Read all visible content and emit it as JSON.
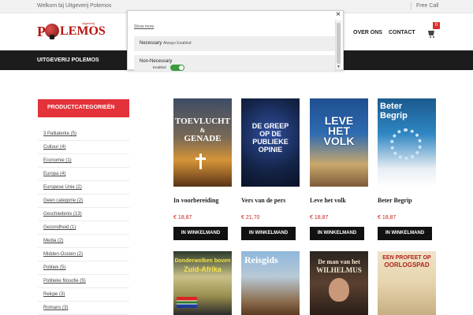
{
  "topbar": {
    "welcome": "Welkom bij Uitgeverij Polemos",
    "call": "Free Call"
  },
  "logo": {
    "text_p": "P",
    "text_rest": "LEMOS",
    "subtitle": "uitgeverij"
  },
  "nav": {
    "over_ons": "OVER ONS",
    "contact": "CONTACT",
    "cart_count": "0"
  },
  "darkbar": {
    "brand": "UITGEVERIJ POLEMOS"
  },
  "cookie": {
    "show_more": "Show more",
    "necessary": "Necessary",
    "always_enabled": "Always Enabled",
    "non_necessary": "Non-Necessary",
    "enabled": "Enabled",
    "close": "×"
  },
  "sidebar": {
    "title": "PRODUCTCATEGORIEËN",
    "items": [
      "3 Palliaterke (5)",
      "Cultuur (4)",
      "Economie (1)",
      "Europa (4)",
      "Europese Unie (2)",
      "Geen categorie (2)",
      "Geschiedenis (13)",
      "Gezondheid (1)",
      "Media (2)",
      "Midden-Oosten (2)",
      "Politiek (5)",
      "Politieke filosofie (5)",
      "Religie (3)",
      "Romans (3)"
    ]
  },
  "products": [
    {
      "title": "In voorbereiding",
      "price": "€ 18,87",
      "button": "IN WINKELMAND",
      "cover_text": [
        "TOEVLUCHT",
        "&",
        "GENADE"
      ]
    },
    {
      "title": "Vers van de pers",
      "price": "€ 21,70",
      "button": "IN WINKELMAND",
      "cover_text": [
        "DE GREEP",
        "OP DE",
        "PUBLIEKE",
        "OPINIE"
      ]
    },
    {
      "title": "Leve het volk",
      "price": "€ 18,87",
      "button": "IN WINKELMAND",
      "cover_text": [
        "LEVE",
        "HET",
        "VOLK"
      ]
    },
    {
      "title": "Beter Begrip",
      "price": "€ 18,87",
      "button": "IN WINKELMAND",
      "cover_text": [
        "Beter",
        "Begrip"
      ]
    }
  ],
  "products_row2": [
    {
      "cover_text": [
        "Donderwolken boven",
        "Zuid-Afrika"
      ]
    },
    {
      "cover_text": [
        "Reisgids"
      ]
    },
    {
      "cover_text": [
        "De man van het",
        "WILHELMUS"
      ]
    },
    {
      "cover_text": [
        "EEN PROFEET OP",
        "OORLOGSPAD"
      ]
    }
  ],
  "colors": {
    "accent": "#e3323a",
    "dark": "#1c1c1c",
    "price": "#c8251f"
  }
}
